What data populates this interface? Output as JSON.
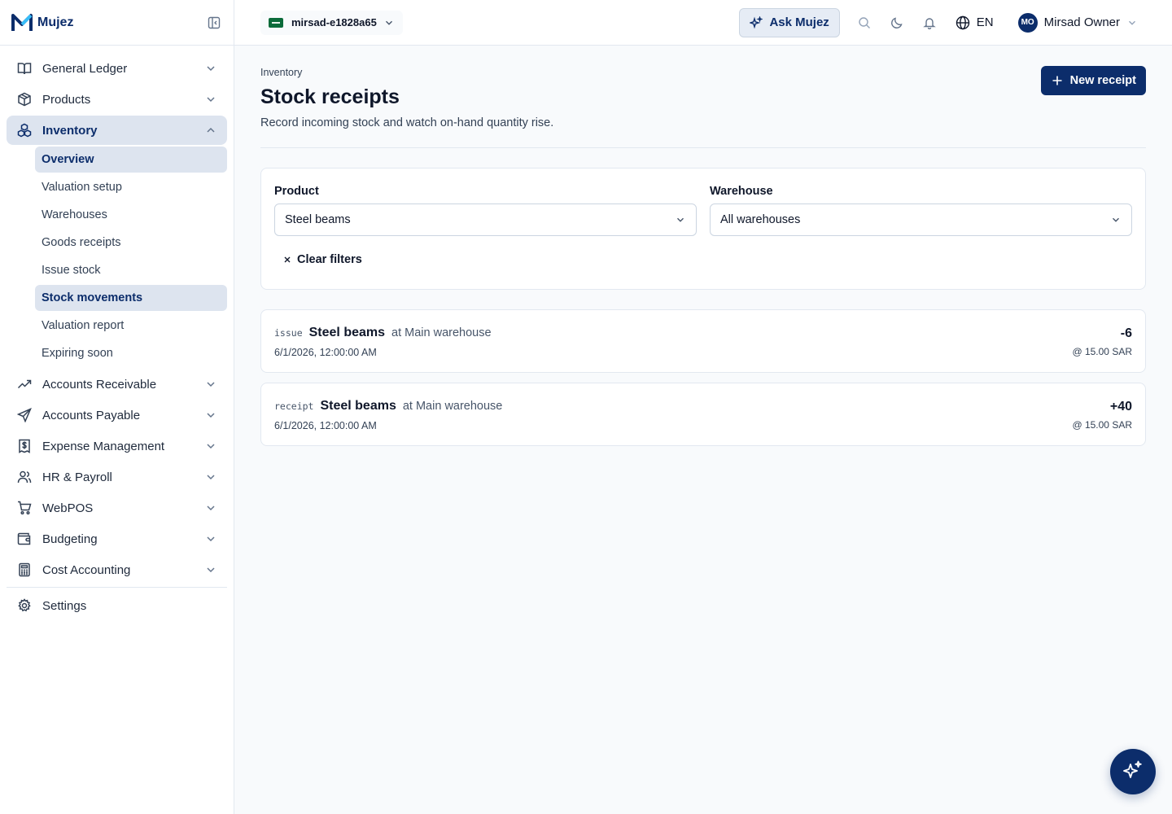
{
  "brand": {
    "name": "Mujez"
  },
  "sidebar": {
    "items": [
      {
        "label": "General Ledger",
        "icon": "book-open-icon"
      },
      {
        "label": "Products",
        "icon": "package-icon"
      },
      {
        "label": "Inventory",
        "icon": "boxes-icon",
        "expanded": true
      },
      {
        "label": "Accounts Receivable",
        "icon": "trending-up-icon"
      },
      {
        "label": "Accounts Payable",
        "icon": "send-icon"
      },
      {
        "label": "Expense Management",
        "icon": "receipt-dollar-icon"
      },
      {
        "label": "HR & Payroll",
        "icon": "users-icon"
      },
      {
        "label": "WebPOS",
        "icon": "cart-icon"
      },
      {
        "label": "Budgeting",
        "icon": "wallet-icon"
      },
      {
        "label": "Cost Accounting",
        "icon": "calculator-icon"
      }
    ],
    "inventory_sub": [
      {
        "label": "Overview",
        "active": true
      },
      {
        "label": "Valuation setup"
      },
      {
        "label": "Warehouses"
      },
      {
        "label": "Goods receipts"
      },
      {
        "label": "Issue stock"
      },
      {
        "label": "Stock movements",
        "active": true
      },
      {
        "label": "Valuation report"
      },
      {
        "label": "Expiring soon"
      }
    ],
    "settings": {
      "label": "Settings",
      "icon": "gear-icon"
    }
  },
  "topbar": {
    "org": "mirsad-e1828a65",
    "ask": "Ask Mujez",
    "lang": "EN",
    "user_initials": "MO",
    "user_name": "Mirsad Owner"
  },
  "page": {
    "breadcrumb": "Inventory",
    "title": "Stock receipts",
    "subtitle": "Record incoming stock and watch on-hand quantity rise.",
    "new_button": "New receipt"
  },
  "filters": {
    "product_label": "Product",
    "product_value": "Steel beams",
    "warehouse_label": "Warehouse",
    "warehouse_value": "All warehouses",
    "clear": "Clear filters"
  },
  "movements": [
    {
      "type": "issue",
      "product": "Steel beams",
      "location": "at Main warehouse",
      "date": "6/1/2026, 12:00:00 AM",
      "qty": "-6",
      "price": "@ 15.00 SAR"
    },
    {
      "type": "receipt",
      "product": "Steel beams",
      "location": "at Main warehouse",
      "date": "6/1/2026, 12:00:00 AM",
      "qty": "+40",
      "price": "@ 15.00 SAR"
    }
  ],
  "colors": {
    "primary": "#0c2d6b",
    "active_bg": "#dde4ef",
    "border": "#e2e8f0"
  }
}
